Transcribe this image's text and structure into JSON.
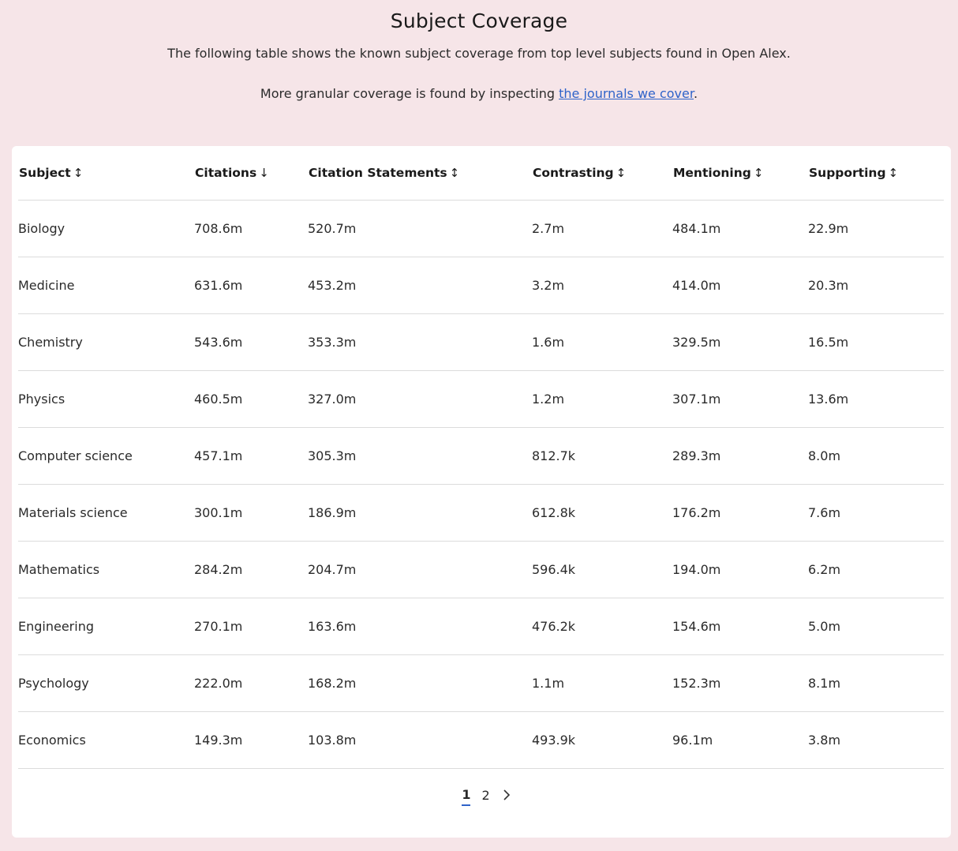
{
  "page": {
    "title": "Subject Coverage",
    "intro": "The following table shows the known subject coverage from top level subjects found in Open Alex.",
    "granular_prefix": "More granular coverage is found by inspecting ",
    "granular_link": "the journals we cover",
    "granular_suffix": "."
  },
  "table": {
    "columns": [
      {
        "label": "Subject",
        "sort": "↕",
        "sort_icon": "sort-icon"
      },
      {
        "label": "Citations",
        "sort": "↓",
        "sort_icon": "sort-descending-icon"
      },
      {
        "label": "Citation Statements",
        "sort": "↕",
        "sort_icon": "sort-icon"
      },
      {
        "label": "Contrasting",
        "sort": "↕",
        "sort_icon": "sort-icon"
      },
      {
        "label": "Mentioning",
        "sort": "↕",
        "sort_icon": "sort-icon"
      },
      {
        "label": "Supporting",
        "sort": "↕",
        "sort_icon": "sort-icon"
      }
    ],
    "rows": [
      [
        "Biology",
        "708.6m",
        "520.7m",
        "2.7m",
        "484.1m",
        "22.9m"
      ],
      [
        "Medicine",
        "631.6m",
        "453.2m",
        "3.2m",
        "414.0m",
        "20.3m"
      ],
      [
        "Chemistry",
        "543.6m",
        "353.3m",
        "1.6m",
        "329.5m",
        "16.5m"
      ],
      [
        "Physics",
        "460.5m",
        "327.0m",
        "1.2m",
        "307.1m",
        "13.6m"
      ],
      [
        "Computer science",
        "457.1m",
        "305.3m",
        "812.7k",
        "289.3m",
        "8.0m"
      ],
      [
        "Materials science",
        "300.1m",
        "186.9m",
        "612.8k",
        "176.2m",
        "7.6m"
      ],
      [
        "Mathematics",
        "284.2m",
        "204.7m",
        "596.4k",
        "194.0m",
        "6.2m"
      ],
      [
        "Engineering",
        "270.1m",
        "163.6m",
        "476.2k",
        "154.6m",
        "5.0m"
      ],
      [
        "Psychology",
        "222.0m",
        "168.2m",
        "1.1m",
        "152.3m",
        "8.1m"
      ],
      [
        "Economics",
        "149.3m",
        "103.8m",
        "493.9k",
        "96.1m",
        "3.8m"
      ]
    ]
  },
  "pagination": {
    "pages": [
      "1",
      "2"
    ],
    "current": "1",
    "next_icon": "chevron-right-icon"
  },
  "colors": {
    "background": "#f6e5e8",
    "link": "#2f63c9",
    "active_page_underline": "#2f63c9"
  }
}
